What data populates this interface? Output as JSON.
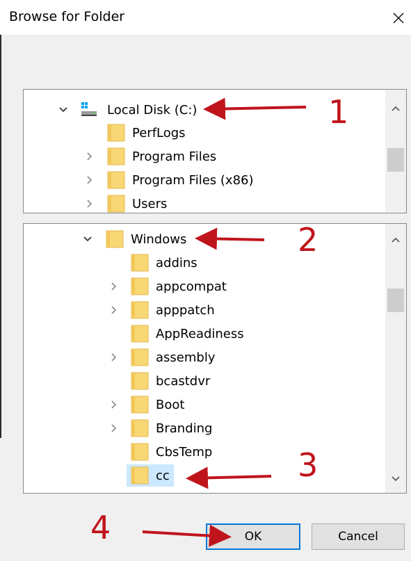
{
  "dialog": {
    "title": "Browse for Folder"
  },
  "pane1": {
    "items": [
      {
        "label": "Local Disk (C:)",
        "expanded": true,
        "icon": "drive-icon"
      },
      {
        "label": "PerfLogs",
        "expanded": false,
        "icon": "folder-icon"
      },
      {
        "label": "Program Files",
        "expanded": false,
        "icon": "folder-icon"
      },
      {
        "label": "Program Files (x86)",
        "expanded": false,
        "icon": "folder-icon"
      },
      {
        "label": "Users",
        "expanded": false,
        "icon": "folder-icon"
      }
    ]
  },
  "pane2": {
    "items": [
      {
        "label": "Windows",
        "expanded": true
      },
      {
        "label": "addins"
      },
      {
        "label": "appcompat"
      },
      {
        "label": "apppatch"
      },
      {
        "label": "AppReadiness"
      },
      {
        "label": "assembly"
      },
      {
        "label": "bcastdvr"
      },
      {
        "label": "Boot"
      },
      {
        "label": "Branding"
      },
      {
        "label": "CbsTemp"
      },
      {
        "label": "cc",
        "selected": true
      }
    ]
  },
  "buttons": {
    "ok_label": "OK",
    "cancel_label": "Cancel"
  },
  "annotations": {
    "step1": "1",
    "step2": "2",
    "step3": "3",
    "step4": "4"
  },
  "colors": {
    "annotation": "#c0141c",
    "selection": "#cce8ff",
    "focus": "#0078d7",
    "folder": "#f8d775"
  }
}
